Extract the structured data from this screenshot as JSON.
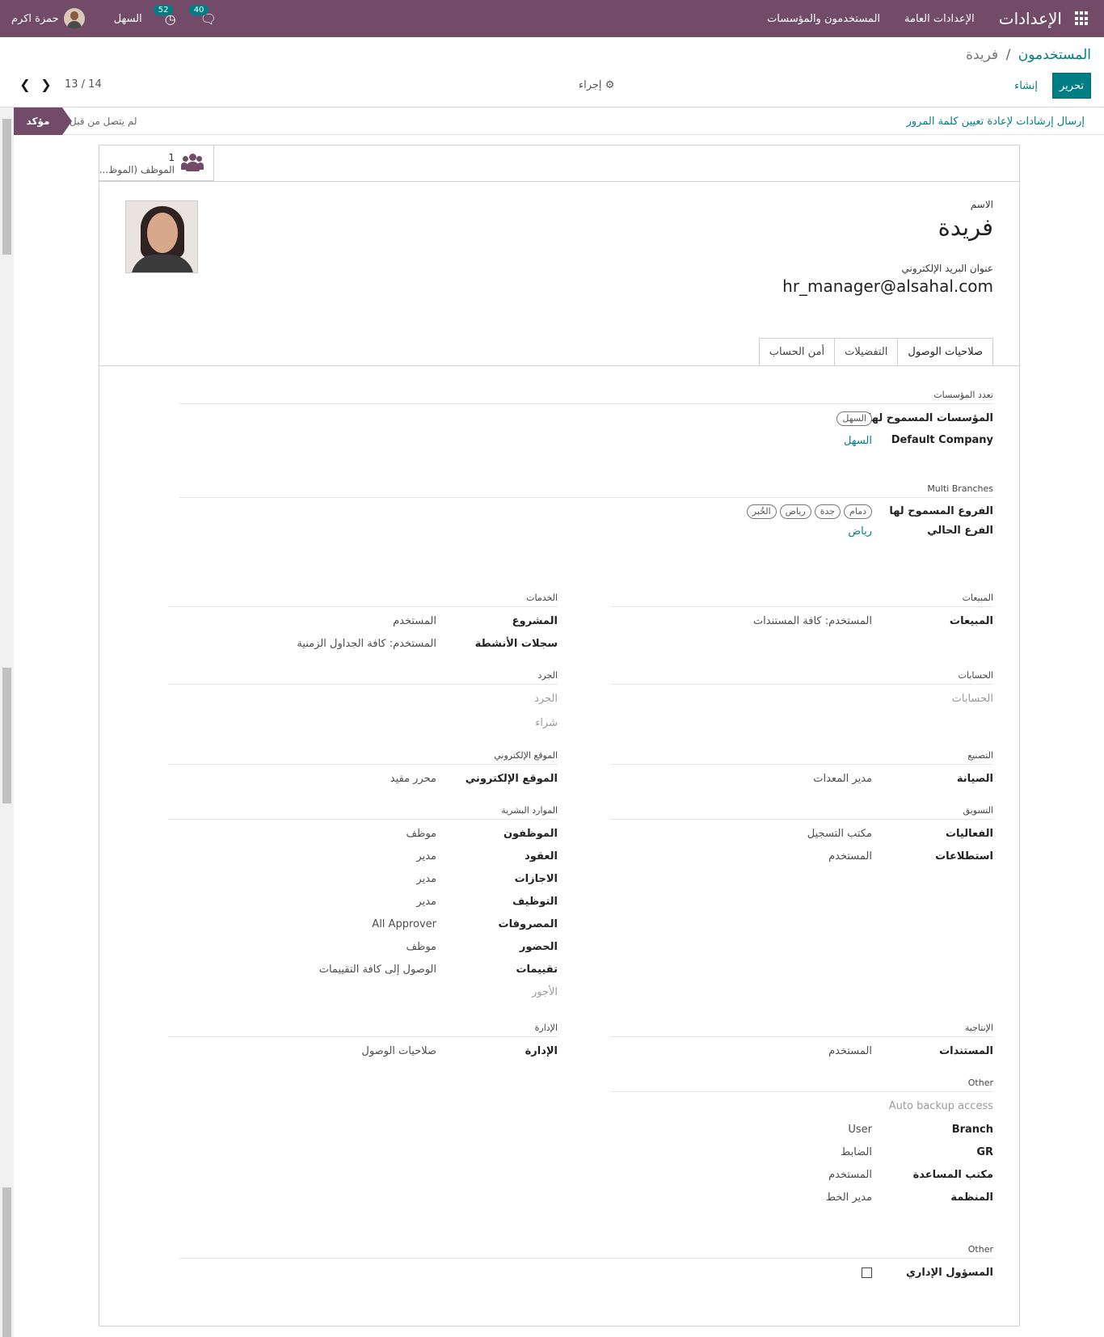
{
  "navbar": {
    "brand": "الإعدادات",
    "menus": [
      "الإعدادات العامة",
      "المستخدمون والمؤسسات"
    ],
    "activity_count": "52",
    "messages_count": "40",
    "company": "السهل",
    "user_name": "حمزة اكرم"
  },
  "breadcrumb": {
    "parent": "المستخدمون",
    "separator": "/",
    "current": "فريدة"
  },
  "buttons": {
    "edit": "تحرير",
    "create": "إنشاء",
    "action": "إجراء"
  },
  "pager": {
    "value": "13 / 14"
  },
  "statusbar": {
    "reset_link": "إرسال إرشادات لإعادة تعيين كلمة المرور",
    "stage_active": "مؤكد",
    "stage_next": "لم يتصل من قبل"
  },
  "smart_button": {
    "value": "1",
    "label": "الموظف (الموظ..."
  },
  "form": {
    "name_label": "الاسم",
    "name": "فريدة",
    "email_label": "عنوان البريد الإلكتروني",
    "email": "hr_manager@alsahal.com"
  },
  "tabs": [
    "صلاحيات الوصول",
    "التفضيلات",
    "أمن الحساب"
  ],
  "multi_company": {
    "title": "تعدد المؤسسات",
    "allowed_label": "المؤسسات المسموح لها",
    "allowed_tags": [
      "السهل"
    ],
    "default_label": "Default Company",
    "default_value": "السهل"
  },
  "multi_branch": {
    "title": "Multi Branches",
    "allowed_label": "الفروع المسموح لها",
    "allowed_tags": [
      "دمام",
      "جدة",
      "رياض",
      "الخُبر"
    ],
    "current_label": "الفرع الحالي",
    "current_value": "رياض"
  },
  "right_groups": {
    "sales": {
      "title": "المبيعات",
      "rows": [
        {
          "label": "المبيعات",
          "value": "المستخدم: كافة المستندات"
        }
      ]
    },
    "accounting": {
      "title": "الحسابات",
      "rows": [
        {
          "label": "الحسابات",
          "value": ""
        }
      ]
    },
    "manufacturing": {
      "title": "التصنيع",
      "rows": [
        {
          "label": "الصيانة",
          "value": "مدير المعدات"
        }
      ]
    },
    "marketing": {
      "title": "التسويق",
      "rows": [
        {
          "label": "الفعاليات",
          "value": "مكتب التسجيل"
        },
        {
          "label": "استطلاعات",
          "value": "المستخدم"
        }
      ]
    },
    "productivity": {
      "title": "الإنتاجية",
      "rows": [
        {
          "label": "المستندات",
          "value": "المستخدم"
        }
      ]
    },
    "other": {
      "title": "Other",
      "rows": [
        {
          "label": "Auto backup access",
          "value": ""
        },
        {
          "label": "Branch",
          "value": "User"
        },
        {
          "label": "GR",
          "value": "الضابط"
        },
        {
          "label": "مكتب المساعدة",
          "value": "المستخدم"
        },
        {
          "label": "المنظمة",
          "value": "مدير الخط"
        }
      ]
    }
  },
  "left_groups": {
    "services": {
      "title": "الخدمات",
      "rows": [
        {
          "label": "المشروع",
          "value": "المستخدم"
        },
        {
          "label": "سجلات الأنشطة",
          "value": "المستخدم: كافة الجداول الزمنية"
        }
      ]
    },
    "inventory": {
      "title": "الجرد",
      "rows": [
        {
          "label": "الجرد",
          "value": ""
        },
        {
          "label": "شراء",
          "value": ""
        }
      ]
    },
    "website": {
      "title": "الموقع الإلكتروني",
      "rows": [
        {
          "label": "الموقع الإلكتروني",
          "value": "محرر مقيد"
        }
      ]
    },
    "hr": {
      "title": "الموارد البشرية",
      "rows": [
        {
          "label": "الموظفون",
          "value": "موظف"
        },
        {
          "label": "العقود",
          "value": "مدير"
        },
        {
          "label": "الاجازات",
          "value": "مدير"
        },
        {
          "label": "التوظيف",
          "value": "مدير"
        },
        {
          "label": "المصروفات",
          "value": "All Approver"
        },
        {
          "label": "الحضور",
          "value": "موظف"
        },
        {
          "label": "تقييمات",
          "value": "الوصول إلى كافة التقييمات"
        },
        {
          "label": "الأجور",
          "value": ""
        }
      ]
    },
    "administration": {
      "title": "الإدارة",
      "rows": [
        {
          "label": "الإدارة",
          "value": "صلاحيات الوصول"
        }
      ]
    }
  },
  "other_bottom": {
    "title": "Other",
    "rows": [
      {
        "label": "المسؤول الإداري",
        "checked": false
      }
    ]
  },
  "colors": {
    "brand": "#714b67",
    "accent": "#017e84"
  }
}
